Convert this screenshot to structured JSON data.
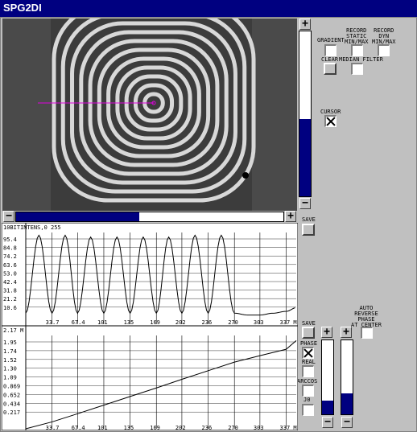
{
  "window": {
    "title": "SPG2DI"
  },
  "controls": {
    "gradient": "GRADIENT",
    "record_static": "RECORD\nSTATIC\nMIN/MAX",
    "record_dyn": "RECORD\nDYN\nMIN/MAX",
    "clear": "CLEAR",
    "median_filter": "MEDIAN FILTER",
    "cursor": "CURSOR",
    "save": "SAVE",
    "phase": "PHASE",
    "real": "REAL",
    "arccos": "ARCCOS",
    "j0": "J0",
    "auto_reverse": "AUTO\nREVERSE\nPHASE\nAT CENTER"
  },
  "checks": {
    "cursor": true,
    "phase": true,
    "gradient": false,
    "record_static": false,
    "record_dyn": false,
    "median_filter": false,
    "real": false,
    "arccos": false,
    "j0": false,
    "auto_reverse": false
  },
  "colors": {
    "navy": "#000080",
    "cursor_line": "#e000e0",
    "panel": "#c0c0c0"
  },
  "icons": {
    "increase": "plus-icon",
    "decrease": "minus-icon"
  },
  "scroll": {
    "image_h_fill_fraction": 0.46,
    "image_v_fill_fraction": 0.47,
    "bar1_fill_fraction": 0.18,
    "bar2_fill_fraction": 0.28
  },
  "intensity_plot": {
    "header": "10BITINTENS,0 255",
    "ylabels": [
      "95.4",
      "84.8",
      "74.2",
      "63.6",
      "53.0",
      "42.4",
      "31.8",
      "21.2",
      "10.6"
    ],
    "xlabels": [
      "33.7",
      "67.4",
      "101",
      "135",
      "169",
      "202",
      "236",
      "270",
      "303",
      "337 M"
    ]
  },
  "phase_plot": {
    "header": "2.17 M",
    "ylabels": [
      "1.95",
      "1.74",
      "1.52",
      "1.30",
      "1.09",
      "0.869",
      "0.652",
      "0.434",
      "0.217"
    ],
    "xlabels": [
      "33.7",
      "67.4",
      "101",
      "135",
      "169",
      "202",
      "236",
      "270",
      "303",
      "337 M"
    ]
  },
  "chart_data": [
    {
      "type": "line",
      "title": "10BITINTENS,0 255",
      "x": [
        0,
        17,
        34,
        51,
        67,
        84,
        101,
        118,
        135,
        152,
        169,
        185,
        202,
        219,
        236,
        253,
        270,
        287,
        303,
        320,
        337,
        350
      ],
      "y": [
        12,
        97,
        12,
        97,
        12,
        95,
        12,
        95,
        12,
        95,
        12,
        95,
        12,
        97,
        12,
        97,
        12,
        10,
        10,
        12,
        14,
        18
      ],
      "ylim": [
        0,
        100
      ],
      "xlim": [
        0,
        350
      ]
    },
    {
      "type": "line",
      "title": "2.17 M",
      "x": [
        0,
        34,
        67,
        101,
        135,
        169,
        202,
        236,
        270,
        303,
        337,
        350
      ],
      "y": [
        0.0,
        0.16,
        0.35,
        0.55,
        0.75,
        0.95,
        1.15,
        1.35,
        1.55,
        1.7,
        1.85,
        2.05
      ],
      "ylim": [
        0,
        2.17
      ],
      "xlim": [
        0,
        350
      ]
    }
  ]
}
